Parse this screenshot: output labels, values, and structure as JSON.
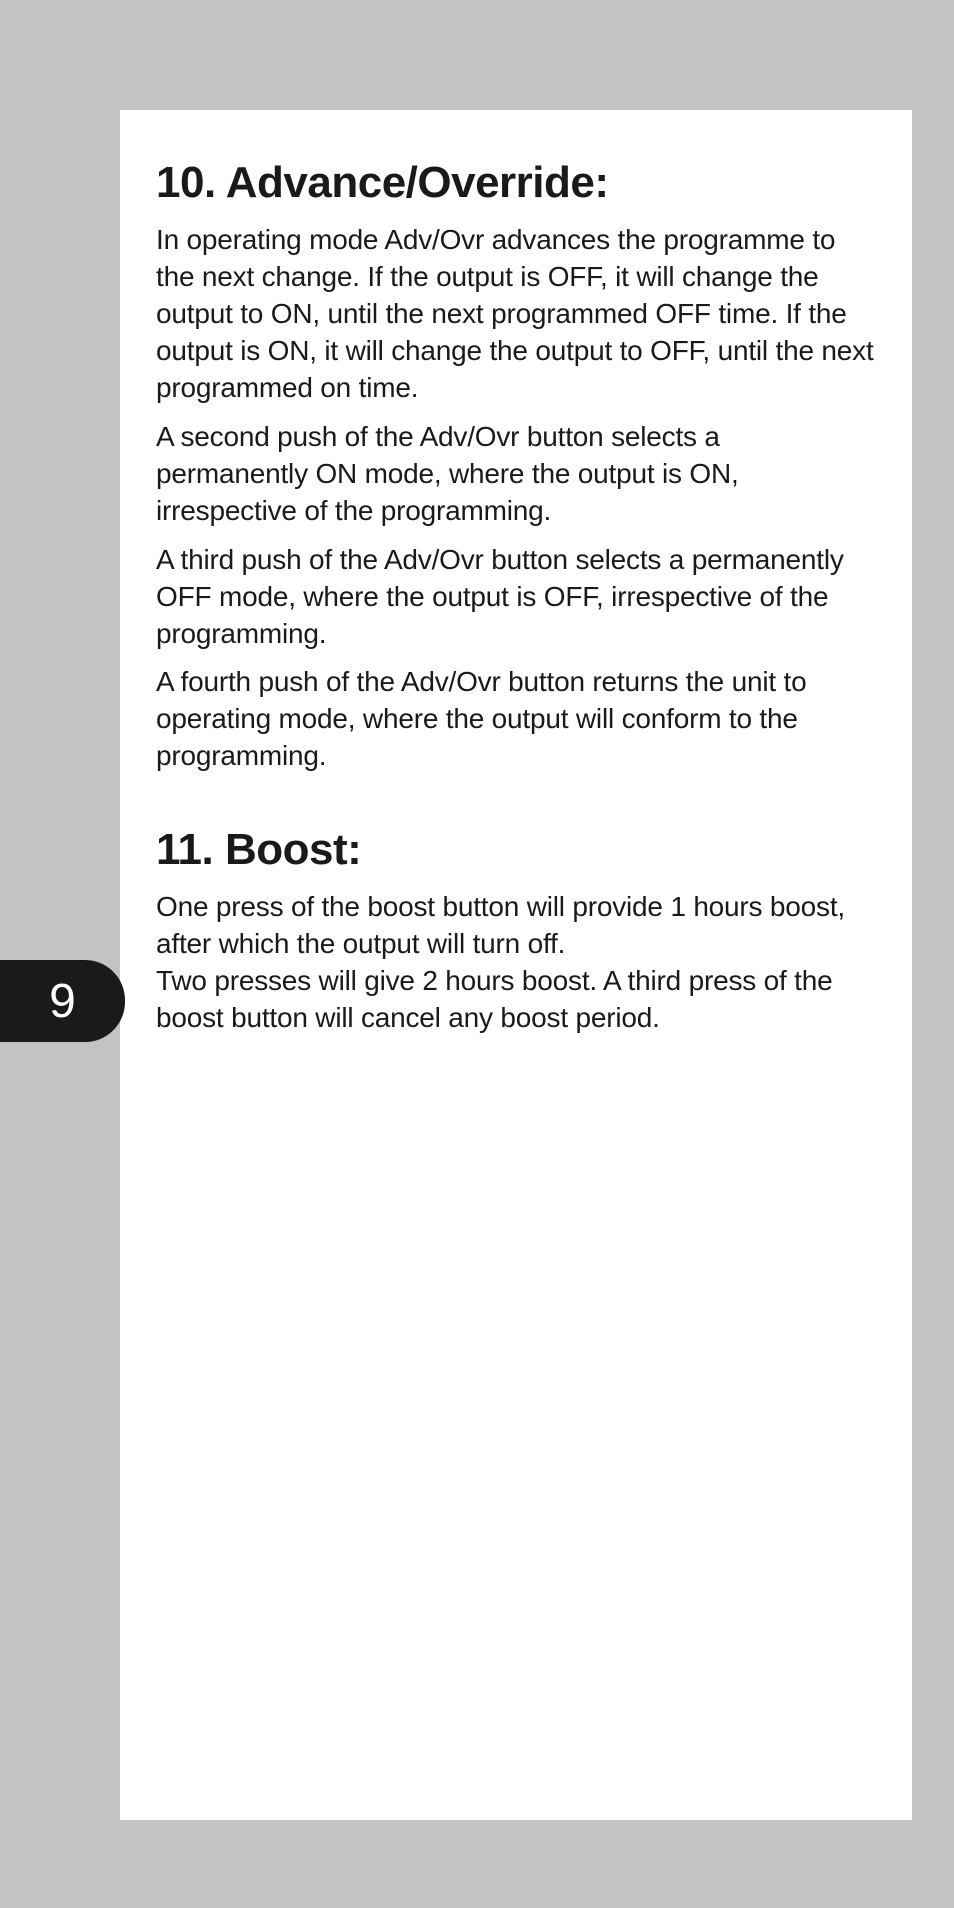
{
  "page_number": "9",
  "sections": [
    {
      "heading": "10. Advance/Override:",
      "paragraphs": [
        "In operating mode Adv/Ovr advances the programme to the next change. If the output is OFF, it will change the output to ON, until the next programmed OFF time. If the output is ON, it will change the output to OFF, until the next programmed on time.",
        "A second push of the Adv/Ovr button selects a permanently ON mode, where the output is ON, irrespective of the programming.",
        "A third push of the Adv/Ovr button selects a permanently OFF mode, where the output is OFF, irrespective of the programming.",
        "A fourth push of the Adv/Ovr button returns the unit to operating mode, where the output will conform to the programming."
      ]
    },
    {
      "heading": "11. Boost:",
      "paragraphs": [
        "One press of the boost button will provide 1 hours boost, after which the output will turn off.",
        "Two presses will give 2 hours boost. A third press of the boost button will cancel any boost period."
      ]
    }
  ]
}
